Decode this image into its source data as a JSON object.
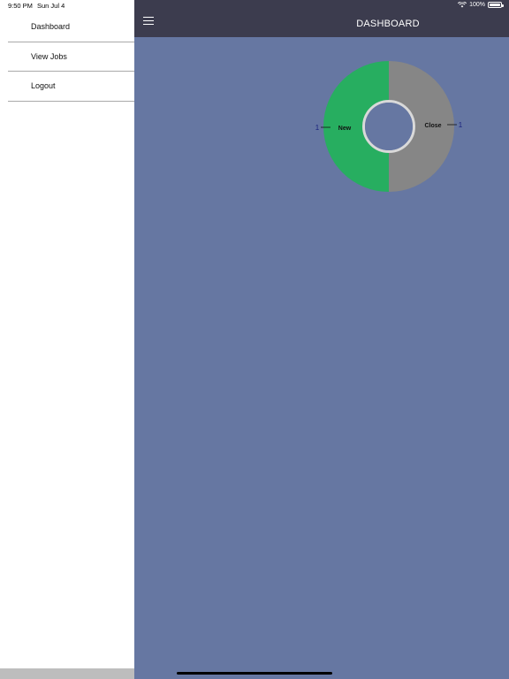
{
  "status": {
    "time": "9:50 PM",
    "date": "Sun Jul 4",
    "battery": "100%",
    "battery_level": 1.0
  },
  "sidebar": {
    "items": [
      {
        "label": "Dashboard",
        "icon": null
      },
      {
        "label": "View Jobs",
        "icon": null
      },
      {
        "label": "Logout",
        "icon": null
      }
    ]
  },
  "header": {
    "title": "DASHBOARD",
    "menu_icon": "hamburger-icon"
  },
  "chart_data": {
    "type": "pie",
    "donut": true,
    "categories": [
      "New",
      "Close"
    ],
    "values": [
      1,
      1
    ],
    "colors": [
      "#27ae60",
      "#868686"
    ],
    "data_labels": [
      "1",
      "1"
    ],
    "title": "",
    "legend": "none"
  },
  "colors": {
    "background": "#6677a2",
    "navbar": "#3c3c4e",
    "sidebar": "#ffffff",
    "accent_green": "#27ae60",
    "gray": "#868686"
  }
}
